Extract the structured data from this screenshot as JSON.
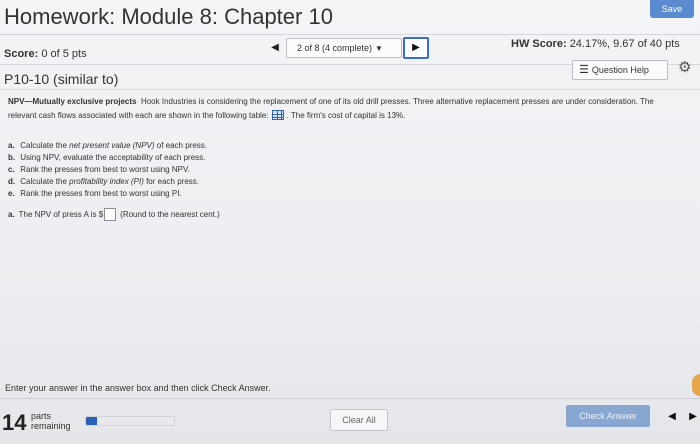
{
  "header": {
    "title": "Homework: Module 8: Chapter 10",
    "save_label": "Save"
  },
  "score": {
    "label": "Score:",
    "value": "0 of 5 pts"
  },
  "navigation": {
    "prev_icon": "triangle-left-icon",
    "question_position": "2 of 8 (4 complete)",
    "next_icon": "triangle-right-icon"
  },
  "hw_score": {
    "label": "HW Score:",
    "value": "24.17%, 9.67 of 40 pts"
  },
  "problem": {
    "id": "P10-10 (similar to)",
    "question_help_label": "Question Help",
    "title_bold": "NPV—Mutually exclusive projects",
    "text_part1": "Hook Industries is considering the replacement of one of its old drill presses. Three alternative replacement presses are under consideration. The relevant cash flows associated with each are shown in the following table:",
    "text_part2": ". The firm's cost of capital is 13%.",
    "tasks": [
      {
        "label": "a.",
        "pre": "Calculate the ",
        "italic": "net present value (NPV)",
        "post": " of each press."
      },
      {
        "label": "b.",
        "pre": "Using NPV, evaluate the acceptability of each press.",
        "italic": "",
        "post": ""
      },
      {
        "label": "c.",
        "pre": "Rank the presses from best to worst using NPV.",
        "italic": "",
        "post": ""
      },
      {
        "label": "d.",
        "pre": "Calculate the ",
        "italic": "profitability index (PI)",
        "post": " for each press."
      },
      {
        "label": "e.",
        "pre": "Rank the presses from best to worst using PI.",
        "italic": "",
        "post": ""
      }
    ],
    "answer": {
      "label": "a.",
      "prompt": "The NPV of press A is $",
      "value": "",
      "hint": "(Round to the nearest cent.)"
    }
  },
  "footer": {
    "instructions": "Enter your answer in the answer box and then click Check Answer.",
    "parts_remaining_count": "14",
    "parts_label_1": "parts",
    "parts_label_2": "remaining",
    "progress_fraction": 0.12,
    "clear_all_label": "Clear All",
    "check_answer_label": "Check Answer"
  },
  "colors": {
    "accent": "#3b6fc4",
    "progress_fill": "#2c5fb7",
    "check_answer_disabled": "#89a6d3",
    "save_button": "#5a8bd0"
  }
}
